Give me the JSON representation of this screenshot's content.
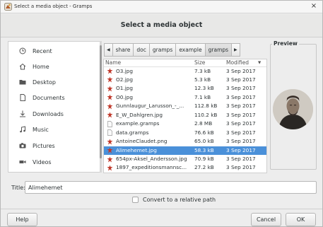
{
  "window": {
    "title": "Select a media object - Gramps",
    "close_glyph": "×"
  },
  "dialog": {
    "heading": "Select a media object"
  },
  "places": [
    {
      "label": "Recent",
      "icon": "clock-icon"
    },
    {
      "label": "Home",
      "icon": "home-icon"
    },
    {
      "label": "Desktop",
      "icon": "folder-icon"
    },
    {
      "label": "Documents",
      "icon": "document-icon"
    },
    {
      "label": "Downloads",
      "icon": "download-icon"
    },
    {
      "label": "Music",
      "icon": "music-icon"
    },
    {
      "label": "Pictures",
      "icon": "camera-icon"
    },
    {
      "label": "Videos",
      "icon": "video-icon"
    }
  ],
  "pathbar": {
    "back_glyph": "◀",
    "forward_glyph": "▶",
    "segments": [
      "share",
      "doc",
      "gramps",
      "example",
      "gramps"
    ]
  },
  "filelist": {
    "columns": {
      "name": "Name",
      "size": "Size",
      "modified": "Modified",
      "sort_glyph": "▼"
    },
    "rows": [
      {
        "name": "O3.jpg",
        "size": "7.3 kB",
        "modified": "3 Sep 2017",
        "type": "image"
      },
      {
        "name": "O2.jpg",
        "size": "5.3 kB",
        "modified": "3 Sep 2017",
        "type": "image"
      },
      {
        "name": "O1.jpg",
        "size": "12.3 kB",
        "modified": "3 Sep 2017",
        "type": "image"
      },
      {
        "name": "O0.jpg",
        "size": "7.1 kB",
        "modified": "3 Sep 2017",
        "type": "image"
      },
      {
        "name": "Gunnlaugur_Larusson_-_...",
        "size": "112.8 kB",
        "modified": "3 Sep 2017",
        "type": "image"
      },
      {
        "name": "E_W_Dahlgren.jpg",
        "size": "110.2 kB",
        "modified": "3 Sep 2017",
        "type": "image"
      },
      {
        "name": "example.gramps",
        "size": "2.8 MB",
        "modified": "3 Sep 2017",
        "type": "file"
      },
      {
        "name": "data.gramps",
        "size": "76.6 kB",
        "modified": "3 Sep 2017",
        "type": "file"
      },
      {
        "name": "AntoineClaudet.png",
        "size": "65.0 kB",
        "modified": "3 Sep 2017",
        "type": "image"
      },
      {
        "name": "Alimehemet.jpg",
        "size": "58.3 kB",
        "modified": "3 Sep 2017",
        "type": "image",
        "selected": true
      },
      {
        "name": "654px-Aksel_Andersson.jpg",
        "size": "70.9 kB",
        "modified": "3 Sep 2017",
        "type": "image"
      },
      {
        "name": "1897_expeditionsmannsc...",
        "size": "27.2 kB",
        "modified": "3 Sep 2017",
        "type": "image"
      }
    ]
  },
  "preview": {
    "label": "Preview"
  },
  "title_field": {
    "label": "Title:",
    "value": "Alimehemet"
  },
  "relative_path": {
    "label": "Convert to a relative path",
    "checked": false
  },
  "buttons": {
    "help": "Help",
    "cancel": "Cancel",
    "ok": "OK"
  },
  "colors": {
    "selection": "#4a90d9",
    "image_icon": "#c0392b"
  }
}
